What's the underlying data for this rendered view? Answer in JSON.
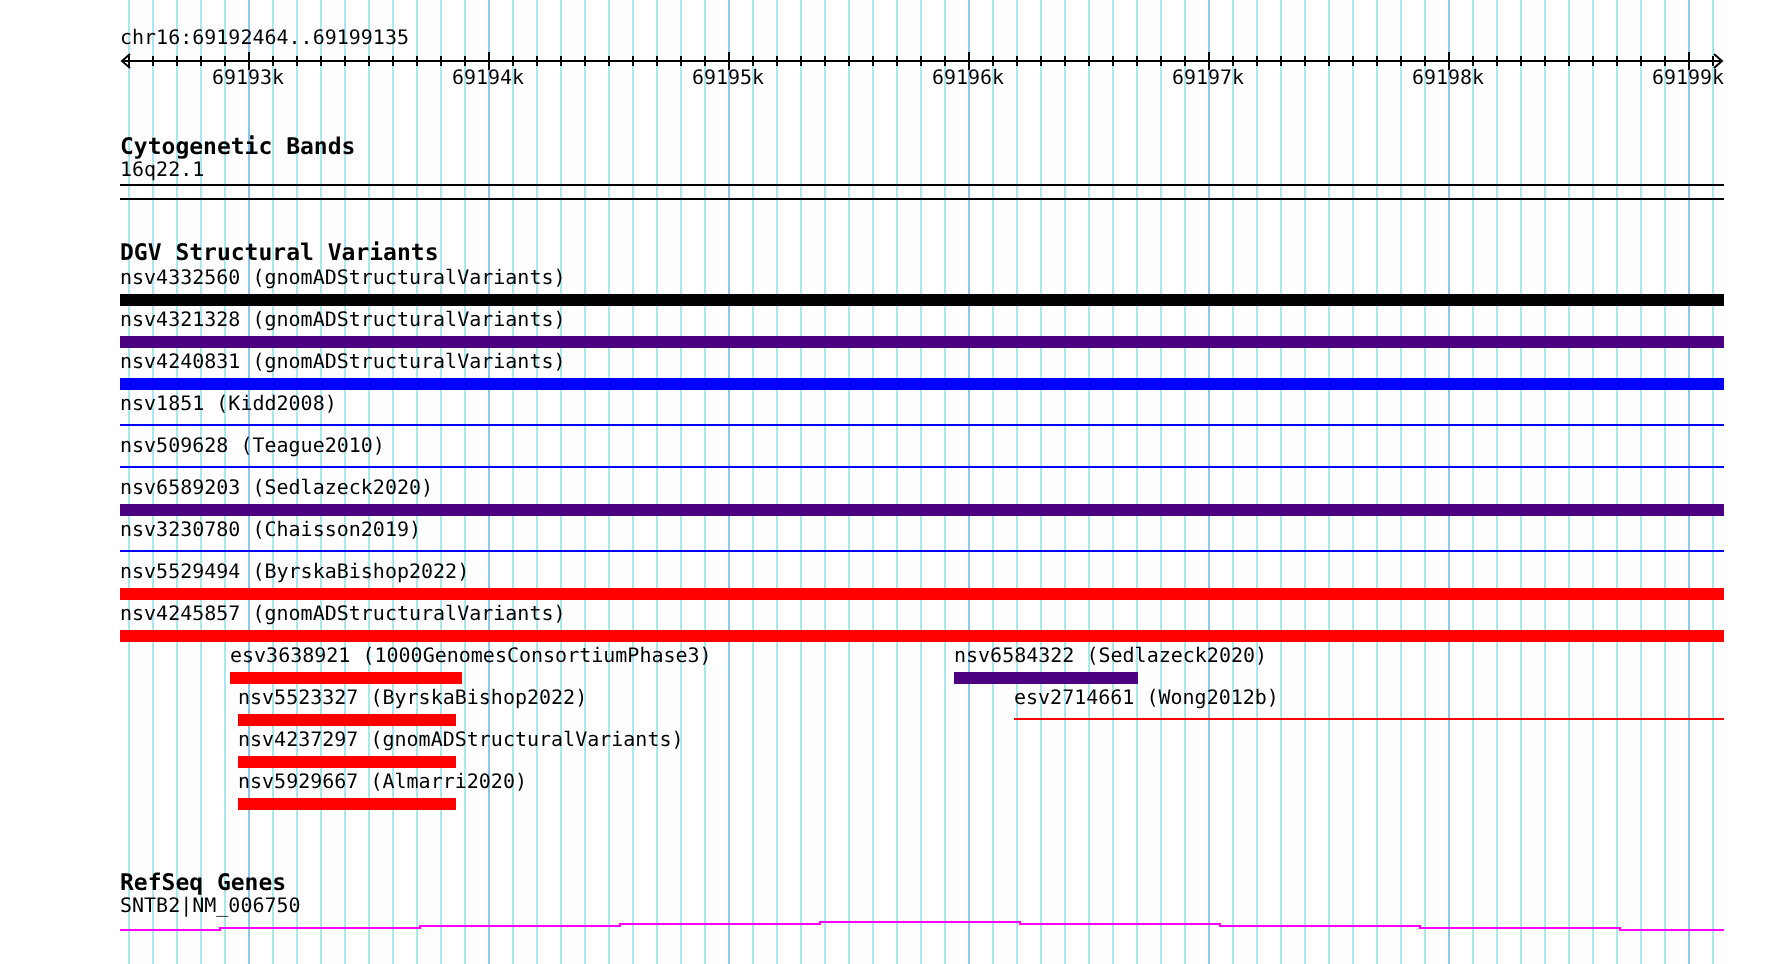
{
  "ruler": {
    "location": "chr16:69192464..69199135",
    "ticks": [
      "69193k",
      "69194k",
      "69195k",
      "69196k",
      "69197k",
      "69198k",
      "69199k"
    ]
  },
  "cytogenetic_bands": {
    "title": "Cytogenetic Bands",
    "features": [
      {
        "label": "16q22.1"
      }
    ]
  },
  "dgv_structural_variants": {
    "title": "DGV Structural Variants",
    "rows": [
      {
        "label": "nsv4332560 (gnomADStructuralVariants)",
        "color": "#000000",
        "kind": "thick"
      },
      {
        "label": "nsv4321328 (gnomADStructuralVariants)",
        "color": "#4b0082",
        "kind": "thick"
      },
      {
        "label": "nsv4240831 (gnomADStructuralVariants)",
        "color": "#0000ff",
        "kind": "thick"
      },
      {
        "label": "nsv1851 (Kidd2008)",
        "color": "#0000ff",
        "kind": "thin"
      },
      {
        "label": "nsv509628 (Teague2010)",
        "color": "#0000ff",
        "kind": "thin"
      },
      {
        "label": "nsv6589203 (Sedlazeck2020)",
        "color": "#4b0082",
        "kind": "thick"
      },
      {
        "label": "nsv3230780 (Chaisson2019)",
        "color": "#0000ff",
        "kind": "thin"
      },
      {
        "label": "nsv5529494 (ByrskaBishop2022)",
        "color": "#ff0000",
        "kind": "thick"
      },
      {
        "label": "nsv4245857 (gnomADStructuralVariants)",
        "color": "#ff0000",
        "kind": "thick"
      }
    ],
    "stacked": [
      {
        "label": "esv3638921 (1000GenomesConsortiumPhase3)",
        "color": "#ff0000",
        "kind": "thick"
      },
      {
        "label": "nsv6584322 (Sedlazeck2020)",
        "color": "#4b0082",
        "kind": "thick"
      },
      {
        "label": "nsv5523327 (ByrskaBishop2022)",
        "color": "#ff0000",
        "kind": "thick"
      },
      {
        "label": "esv2714661 (Wong2012b)",
        "color": "#ff0000",
        "kind": "thin"
      },
      {
        "label": "nsv4237297 (gnomADStructuralVariants)",
        "color": "#ff0000",
        "kind": "thick"
      },
      {
        "label": "nsv5929667 (Almarri2020)",
        "color": "#ff0000",
        "kind": "thick"
      }
    ]
  },
  "refseq_genes": {
    "title": "RefSeq Genes",
    "features": [
      {
        "label": "SNTB2|NM_006750"
      }
    ]
  }
}
